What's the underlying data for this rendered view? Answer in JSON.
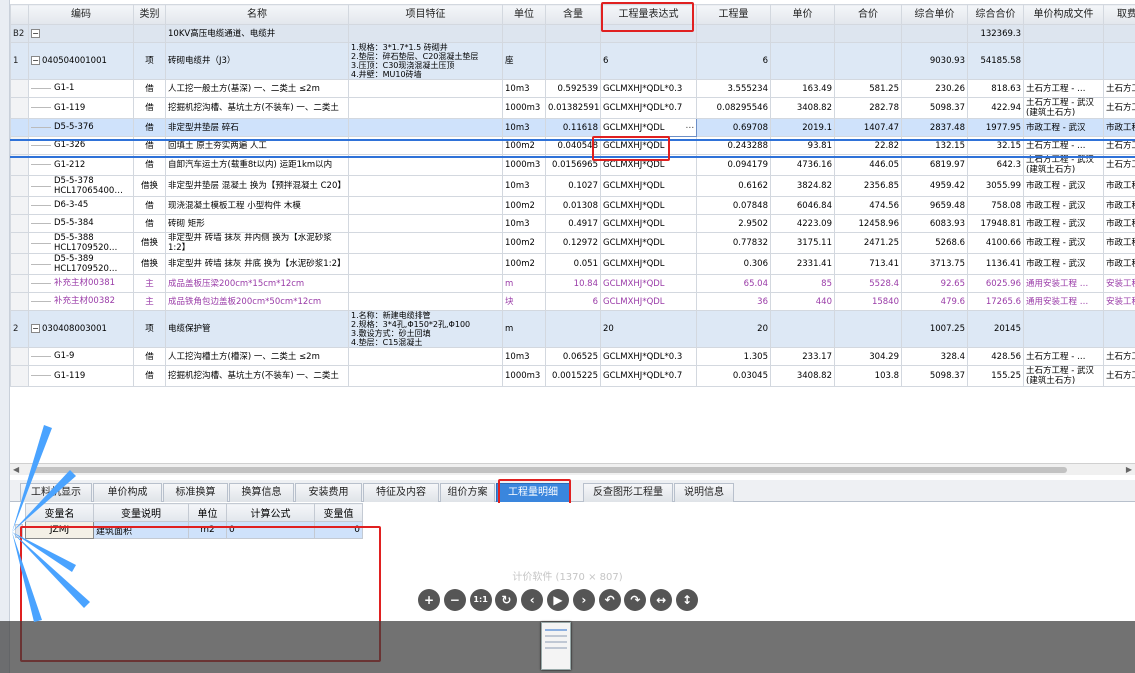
{
  "grid": {
    "headers": [
      "",
      "编码",
      "类别",
      "名称",
      "项目特征",
      "单位",
      "含量",
      "工程量表达式",
      "工程量",
      "单价",
      "合价",
      "综合单价",
      "综合合价",
      "单价构成文件",
      "取费"
    ],
    "section": {
      "code": "B2",
      "name": "10KV高压电缆通道、电缆井",
      "total": "132369.3",
      "expander": "−"
    },
    "rows": [
      {
        "no": "1",
        "code": "040504001001",
        "type": "项",
        "name": "砖砌电缆井（J3）",
        "feature": "1.规格：3*1.7*1.5 砖砌井\n2.垫层：碎石垫层、C20混凝土垫层\n3.压顶：C30现浇混凝土压顶\n4.井壁：MU10砖墙",
        "unit": "座",
        "content": "",
        "expr": "6",
        "qty": "6",
        "price": "",
        "sum": "",
        "cprice": "9030.93",
        "csum": "54185.58",
        "file": "",
        "fee": ""
      },
      {
        "no": "",
        "code": "G1-1",
        "type": "借",
        "name": "人工挖一般土方(基深) 一、二类土 ≤2m",
        "feature": "",
        "unit": "10m3",
        "content": "0.592539",
        "expr": "GCLMXHJ*QDL*0.3",
        "qty": "3.555234",
        "price": "163.49",
        "sum": "581.25",
        "cprice": "230.26",
        "csum": "818.63",
        "file": "土石方工程 - …",
        "fee": "土石方工"
      },
      {
        "no": "",
        "code": "G1-119",
        "type": "借",
        "name": "挖掘机挖沟槽、基坑土方(不装车) 一、二类土",
        "feature": "",
        "unit": "1000m3",
        "content": "0.01382591",
        "expr": "GCLMXHJ*QDL*0.7",
        "qty": "0.08295546",
        "price": "3408.82",
        "sum": "282.78",
        "cprice": "5098.37",
        "csum": "422.94",
        "file": "土石方工程 - 武汉(建筑土石方)",
        "fee": "土石方工"
      },
      {
        "no": "",
        "code": "D5-5-376",
        "type": "借",
        "name": "非定型井垫层 碎石",
        "feature": "",
        "unit": "10m3",
        "content": "0.11618",
        "expr": "GCLMXHJ*QDL",
        "qty": "0.69708",
        "price": "2019.1",
        "sum": "1407.47",
        "cprice": "2837.48",
        "csum": "1977.95",
        "file": "市政工程 - 武汉",
        "fee": "市政工程"
      },
      {
        "no": "",
        "code": "G1-326",
        "type": "借",
        "name": "回填土 原土夯实两遍 人工",
        "feature": "",
        "unit": "100m2",
        "content": "0.040548",
        "expr": "GCLMXHJ*QDL",
        "qty": "0.243288",
        "price": "93.81",
        "sum": "22.82",
        "cprice": "132.15",
        "csum": "32.15",
        "file": "土石方工程 - …",
        "fee": "土石方工"
      },
      {
        "no": "",
        "code": "G1-212",
        "type": "借",
        "name": "自卸汽车运土方(载重8t以内) 运距1km以内",
        "feature": "",
        "unit": "1000m3",
        "content": "0.0156965",
        "expr": "GCLMXHJ*QDL",
        "qty": "0.094179",
        "price": "4736.16",
        "sum": "446.05",
        "cprice": "6819.97",
        "csum": "642.3",
        "file": "土石方工程 - 武汉(建筑土石方)",
        "fee": "土石方工"
      },
      {
        "no": "",
        "code": "D5-5-378\nHCL17065400…",
        "type": "借换",
        "name": "非定型井垫层 混凝土  换为【预拌混凝土 C20】",
        "feature": "",
        "unit": "10m3",
        "content": "0.1027",
        "expr": "GCLMXHJ*QDL",
        "qty": "0.6162",
        "price": "3824.82",
        "sum": "2356.85",
        "cprice": "4959.42",
        "csum": "3055.99",
        "file": "市政工程 - 武汉",
        "fee": "市政工程"
      },
      {
        "no": "",
        "code": "D6-3-45",
        "type": "借",
        "name": "现浇混凝土模板工程 小型构件 木模",
        "feature": "",
        "unit": "100m2",
        "content": "0.01308",
        "expr": "GCLMXHJ*QDL",
        "qty": "0.07848",
        "price": "6046.84",
        "sum": "474.56",
        "cprice": "9659.48",
        "csum": "758.08",
        "file": "市政工程 - 武汉",
        "fee": "市政工程"
      },
      {
        "no": "",
        "code": "D5-5-384",
        "type": "借",
        "name": "砖砌 矩形",
        "feature": "",
        "unit": "10m3",
        "content": "0.4917",
        "expr": "GCLMXHJ*QDL",
        "qty": "2.9502",
        "price": "4223.09",
        "sum": "12458.96",
        "cprice": "6083.93",
        "csum": "17948.81",
        "file": "市政工程 - 武汉",
        "fee": "市政工程"
      },
      {
        "no": "",
        "code": "D5-5-388\nHCL1709520…",
        "type": "借换",
        "name": "非定型井 砖墙 抹灰 井内侧  换为【水泥砂浆1:2】",
        "feature": "",
        "unit": "100m2",
        "content": "0.12972",
        "expr": "GCLMXHJ*QDL",
        "qty": "0.77832",
        "price": "3175.11",
        "sum": "2471.25",
        "cprice": "5268.6",
        "csum": "4100.66",
        "file": "市政工程 - 武汉",
        "fee": "市政工程"
      },
      {
        "no": "",
        "code": "D5-5-389\nHCL1709520…",
        "type": "借换",
        "name": "非定型井 砖墙 抹灰 井底  换为【水泥砂浆1:2】",
        "feature": "",
        "unit": "100m2",
        "content": "0.051",
        "expr": "GCLMXHJ*QDL",
        "qty": "0.306",
        "price": "2331.41",
        "sum": "713.41",
        "cprice": "3713.75",
        "csum": "1136.41",
        "file": "市政工程 - 武汉",
        "fee": "市政工程"
      },
      {
        "no": "",
        "code": "补充主材00381",
        "type": "主",
        "name": "成品盖板压梁200cm*15cm*12cm",
        "feature": "",
        "unit": "m",
        "content": "10.84",
        "expr": "GCLMXHJ*QDL",
        "qty": "65.04",
        "price": "85",
        "sum": "5528.4",
        "cprice": "92.65",
        "csum": "6025.96",
        "file": "通用安装工程 …",
        "fee": "安装工程"
      },
      {
        "no": "",
        "code": "补充主材00382",
        "type": "主",
        "name": "成品铁角包边盖板200cm*50cm*12cm",
        "feature": "",
        "unit": "块",
        "content": "6",
        "expr": "GCLMXHJ*QDL",
        "qty": "36",
        "price": "440",
        "sum": "15840",
        "cprice": "479.6",
        "csum": "17265.6",
        "file": "通用安装工程 …",
        "fee": "安装工程"
      },
      {
        "no": "2",
        "code": "030408003001",
        "type": "项",
        "name": "电缆保护管",
        "feature": "1.名称：新建电缆排管\n2.规格：3*4孔,Φ150*2孔,Φ100\n3.敷设方式：砂土回填\n4.垫层：C15混凝土",
        "unit": "m",
        "content": "",
        "expr": "20",
        "qty": "20",
        "price": "",
        "sum": "",
        "cprice": "1007.25",
        "csum": "20145",
        "file": "",
        "fee": ""
      },
      {
        "no": "",
        "code": "G1-9",
        "type": "借",
        "name": "人工挖沟槽土方(槽深) 一、二类土 ≤2m",
        "feature": "",
        "unit": "10m3",
        "content": "0.06525",
        "expr": "GCLMXHJ*QDL*0.3",
        "qty": "1.305",
        "price": "233.17",
        "sum": "304.29",
        "cprice": "328.4",
        "csum": "428.56",
        "file": "土石方工程 - …",
        "fee": "土石方工"
      },
      {
        "no": "",
        "code": "G1-119",
        "type": "借",
        "name": "挖掘机挖沟槽、基坑土方(不装车) 一、二类土",
        "feature": "",
        "unit": "1000m3",
        "content": "0.0015225",
        "expr": "GCLMXHJ*QDL*0.7",
        "qty": "0.03045",
        "price": "3408.82",
        "sum": "103.8",
        "cprice": "5098.37",
        "csum": "155.25",
        "file": "土石方工程 - 武汉(建筑土石方)",
        "fee": "土石方工"
      }
    ]
  },
  "tabs": [
    "工料机显示",
    "单价构成",
    "标准换算",
    "换算信息",
    "安装费用",
    "特征及内容",
    "组价方案",
    "工程量明细",
    "反查图形工程量",
    "说明信息"
  ],
  "active_tab": "工程量明细",
  "var_table": {
    "headers": [
      "变量名",
      "变量说明",
      "单位",
      "计算公式",
      "变量值"
    ],
    "row": {
      "name": "JZMJ",
      "desc": "建筑面积",
      "unit": "m2",
      "formula": "0",
      "value": "0"
    }
  },
  "viewer": {
    "title": "计价软件 (1370 × 807)",
    "controls": [
      "zoom-in",
      "zoom-out",
      "actual-size",
      "reset",
      "prev",
      "play",
      "next",
      "rotate-left",
      "rotate-right",
      "flip-horizontal",
      "flip-vertical"
    ]
  },
  "colors": {
    "annotation": "#e02020",
    "active_tab": "#3a86dd",
    "selected_row": "#cfe2fb",
    "group_row": "#dde8f5",
    "purple_text": "#9a3ca8",
    "arrow": "#4aa3ff"
  }
}
